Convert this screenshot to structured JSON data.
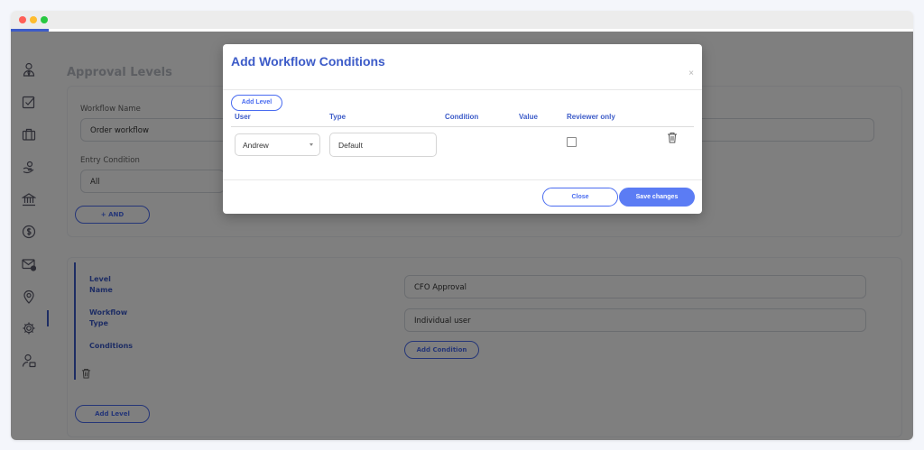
{
  "window": {
    "controls": [
      "close",
      "minimize",
      "maximize"
    ]
  },
  "sidebar": {
    "items": [
      {
        "icon": "user-tie-icon"
      },
      {
        "icon": "checkbox-icon"
      },
      {
        "icon": "briefcase-icon"
      },
      {
        "icon": "hand-coin-icon"
      },
      {
        "icon": "bank-icon"
      },
      {
        "icon": "dollar-icon"
      },
      {
        "icon": "mail-notification-icon"
      },
      {
        "icon": "location-pin-icon"
      },
      {
        "icon": "gear-icon",
        "active": true
      },
      {
        "icon": "user-settings-icon"
      }
    ]
  },
  "page": {
    "title": "Approval Levels",
    "workflow_name_label": "Workflow Name",
    "workflow_name_value": "Order workflow",
    "entry_condition_label": "Entry Condition",
    "entry_condition_value": "All",
    "and_button": "+ AND",
    "level": {
      "name_label_1": "Level",
      "name_label_2": "Name",
      "name_value": "CFO Approval",
      "type_label_1": "Workflow",
      "type_label_2": "Type",
      "type_value": "Individual user",
      "conditions_label": "Conditions",
      "add_condition_button": "Add Condition"
    },
    "add_level_button": "Add Level"
  },
  "modal": {
    "title": "Add Workflow Conditions",
    "close_symbol": "×",
    "add_level_button": "Add Level",
    "columns": [
      "User",
      "Type",
      "Condition",
      "Value",
      "Reviewer only"
    ],
    "row": {
      "user": "Andrew",
      "type": "Default",
      "reviewer_only": false
    },
    "close_button": "Close",
    "save_button": "Save changes"
  },
  "colors": {
    "accent": "#3c5bc8",
    "primary_button": "#5b7cf4"
  }
}
